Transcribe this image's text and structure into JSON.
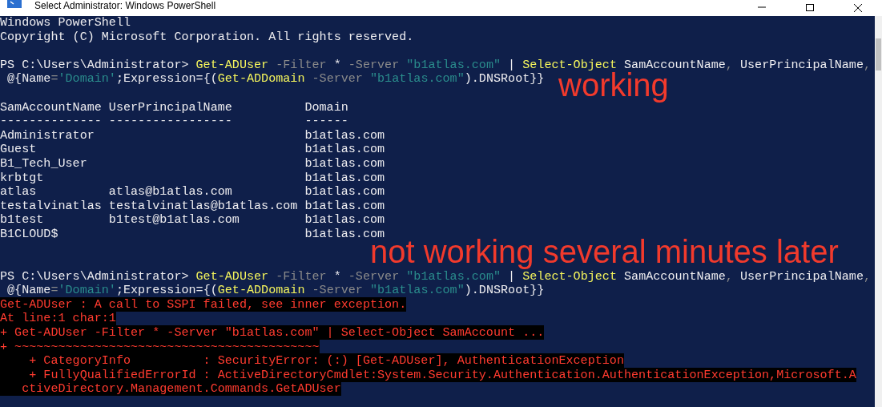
{
  "window": {
    "title": "Select Administrator: Windows PowerShell"
  },
  "console": {
    "lines": [
      {
        "kind": "output",
        "text": "Windows PowerShell"
      },
      {
        "kind": "output",
        "text": "Copyright (C) Microsoft Corporation. All rights reserved."
      },
      {
        "kind": "blank"
      },
      {
        "kind": "command",
        "tokens": [
          {
            "kind": "prompt",
            "text": "PS C:\\Users\\Administrator> "
          },
          {
            "kind": "cmdlet",
            "text": "Get-ADUser"
          },
          {
            "kind": "param",
            "text": " -Filter "
          },
          {
            "kind": "plain",
            "text": "*"
          },
          {
            "kind": "param",
            "text": " -Server "
          },
          {
            "kind": "string",
            "text": "\"b1atlas.com\""
          },
          {
            "kind": "plain",
            "text": " | "
          },
          {
            "kind": "cmdlet",
            "text": "Select-Object"
          },
          {
            "kind": "plain",
            "text": " SamAccountName"
          },
          {
            "kind": "param",
            "text": ", "
          },
          {
            "kind": "plain",
            "text": "UserPrincipalName"
          },
          {
            "kind": "param",
            "text": ","
          }
        ]
      },
      {
        "kind": "command",
        "tokens": [
          {
            "kind": "plain",
            "text": " @{Name"
          },
          {
            "kind": "param",
            "text": "="
          },
          {
            "kind": "string",
            "text": "'Domain'"
          },
          {
            "kind": "plain",
            "text": ";Expression={("
          },
          {
            "kind": "cmdlet",
            "text": "Get-ADDomain"
          },
          {
            "kind": "param",
            "text": " -Server "
          },
          {
            "kind": "string",
            "text": "\"b1atlas.com\""
          },
          {
            "kind": "plain",
            "text": ").DNSRoot}}"
          }
        ]
      },
      {
        "kind": "blank"
      },
      {
        "kind": "output",
        "text": "SamAccountName UserPrincipalName          Domain"
      },
      {
        "kind": "output",
        "text": "-------------- -----------------          ------"
      },
      {
        "kind": "output",
        "text": "Administrator                             b1atlas.com"
      },
      {
        "kind": "output",
        "text": "Guest                                     b1atlas.com"
      },
      {
        "kind": "output",
        "text": "B1_Tech_User                              b1atlas.com"
      },
      {
        "kind": "output",
        "text": "krbtgt                                    b1atlas.com"
      },
      {
        "kind": "output",
        "text": "atlas          atlas@b1atlas.com          b1atlas.com"
      },
      {
        "kind": "output",
        "text": "testalvinatlas testalvinatlas@b1atlas.com b1atlas.com"
      },
      {
        "kind": "output",
        "text": "b1test         b1test@b1atlas.com         b1atlas.com"
      },
      {
        "kind": "output",
        "text": "B1CLOUD$                                  b1atlas.com"
      },
      {
        "kind": "blank"
      },
      {
        "kind": "blank"
      },
      {
        "kind": "command",
        "tokens": [
          {
            "kind": "prompt",
            "text": "PS C:\\Users\\Administrator> "
          },
          {
            "kind": "cmdlet",
            "text": "Get-ADUser"
          },
          {
            "kind": "param",
            "text": " -Filter "
          },
          {
            "kind": "plain",
            "text": "*"
          },
          {
            "kind": "param",
            "text": " -Server "
          },
          {
            "kind": "string",
            "text": "\"b1atlas.com\""
          },
          {
            "kind": "plain",
            "text": " | "
          },
          {
            "kind": "cmdlet",
            "text": "Select-Object"
          },
          {
            "kind": "plain",
            "text": " SamAccountName"
          },
          {
            "kind": "param",
            "text": ", "
          },
          {
            "kind": "plain",
            "text": "UserPrincipalName"
          },
          {
            "kind": "param",
            "text": ","
          }
        ]
      },
      {
        "kind": "command",
        "tokens": [
          {
            "kind": "plain",
            "text": " @{Name"
          },
          {
            "kind": "param",
            "text": "="
          },
          {
            "kind": "string",
            "text": "'Domain'"
          },
          {
            "kind": "plain",
            "text": ";Expression={("
          },
          {
            "kind": "cmdlet",
            "text": "Get-ADDomain"
          },
          {
            "kind": "param",
            "text": " -Server "
          },
          {
            "kind": "string",
            "text": "\"b1atlas.com\""
          },
          {
            "kind": "plain",
            "text": ").DNSRoot}}"
          }
        ]
      },
      {
        "kind": "error",
        "text": "Get-ADUser : A call to SSPI failed, see inner exception."
      },
      {
        "kind": "error",
        "text": "At line:1 char:1"
      },
      {
        "kind": "error",
        "text": "+ Get-ADUser -Filter * -Server \"b1atlas.com\" | Select-Object SamAccount ..."
      },
      {
        "kind": "error",
        "text": "+ ~~~~~~~~~~~~~~~~~~~~~~~~~~~~~~~~~~~~~~~~~~"
      },
      {
        "kind": "error",
        "text": "    + CategoryInfo          : SecurityError: (:) [Get-ADUser], AuthenticationException"
      },
      {
        "kind": "error",
        "text": "    + FullyQualifiedErrorId : ActiveDirectoryCmdlet:System.Security.Authentication.AuthenticationException,Microsoft.A"
      },
      {
        "kind": "error",
        "text": "   ctiveDirectory.Management.Commands.GetADUser"
      }
    ]
  },
  "annotations": [
    {
      "text": "working"
    },
    {
      "text": "not working several minutes later"
    }
  ]
}
